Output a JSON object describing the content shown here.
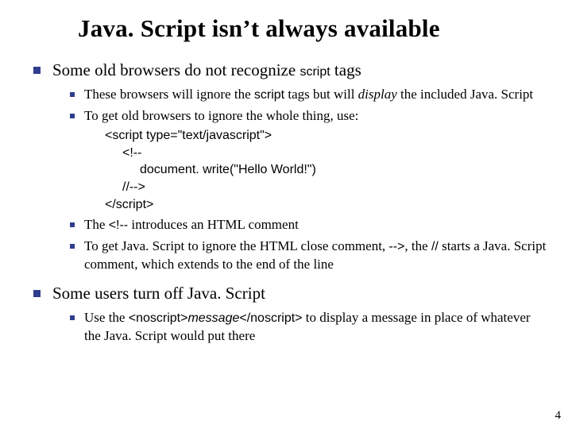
{
  "title": "Java. Script isn’t always available",
  "bullets": {
    "b1": {
      "pre": "Some old browsers do not recognize ",
      "code": "script",
      "post": " tags",
      "sub": {
        "s1": {
          "pre": "These browsers will ignore the ",
          "code": "script",
          "mid": " tags but will ",
          "ital": "display",
          "post": " the included Java. Script"
        },
        "s2": {
          "text": "To get old browsers to ignore the whole thing, use:"
        },
        "codeblock": {
          "l1": "<script type=\"text/javascript\">",
          "l2": "<!--",
          "l3": "document. write(\"Hello World!\")",
          "l4": "//-->",
          "l5": "</script>"
        },
        "s3": {
          "pre": "The ",
          "code": "<!--",
          "post": " introduces an HTML comment"
        },
        "s4": {
          "pre": "To get Java. Script to ignore the HTML close comment, ",
          "code1": "-->",
          "mid": ", the ",
          "code2": "//",
          "post": " starts a Java. Script comment, which extends to the end of the line"
        }
      }
    },
    "b2": {
      "text": "Some users turn off Java. Script",
      "sub": {
        "s1": {
          "pre": "Use the ",
          "code1": "<noscript>",
          "ital": "message",
          "code2": "</noscript>",
          "post": " to display a message in place of whatever the Java. Script would put there"
        }
      }
    }
  },
  "page_number": "4"
}
